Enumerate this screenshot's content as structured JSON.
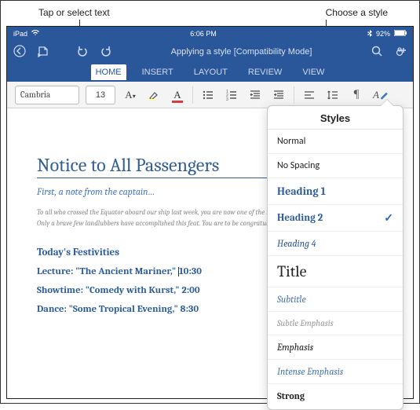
{
  "annotations": {
    "left": "Tap or select text",
    "right": "Choose a style"
  },
  "statusbar": {
    "device": "iPad",
    "wifi": "᯾",
    "time": "6:06 PM",
    "bt": "92%"
  },
  "topbar": {
    "title": "Applying a style [Compatibility Mode]"
  },
  "tabs": {
    "home": "HOME",
    "insert": "INSERT",
    "layout": "LAYOUT",
    "review": "REVIEW",
    "view": "VIEW"
  },
  "toolbar": {
    "font_name": "Cambria",
    "font_size": "13"
  },
  "doc": {
    "title": "Notice to All Passengers",
    "subtitle": "First, a note from the captain…",
    "body": "To all who crossed the Equator aboard our ship last week, you are now one of the noble few. You are to be congratulated. Only a brave few landlubbers have accomplished this feat. You are to be congratulated.",
    "h2": "Today's Festivities",
    "event1a": "Lecture: \"The Ancient Mariner,\" ",
    "event1b": "10:30",
    "event2": "Showtime: \"Comedy with Kurst,\" 2:00",
    "event3": "Dance: \"Some Tropical Evening,\" 8:30"
  },
  "styles_panel": {
    "header": "Styles",
    "items": {
      "normal": "Normal",
      "nospacing": "No Spacing",
      "h1": "Heading 1",
      "h2": "Heading 2",
      "h4": "Heading 4",
      "title": "Title",
      "subtitle": "Subtitle",
      "subtleemph": "Subtle Emphasis",
      "emphasis": "Emphasis",
      "intenseemph": "Intense Emphasis",
      "strong": "Strong"
    },
    "selected": "h2"
  }
}
